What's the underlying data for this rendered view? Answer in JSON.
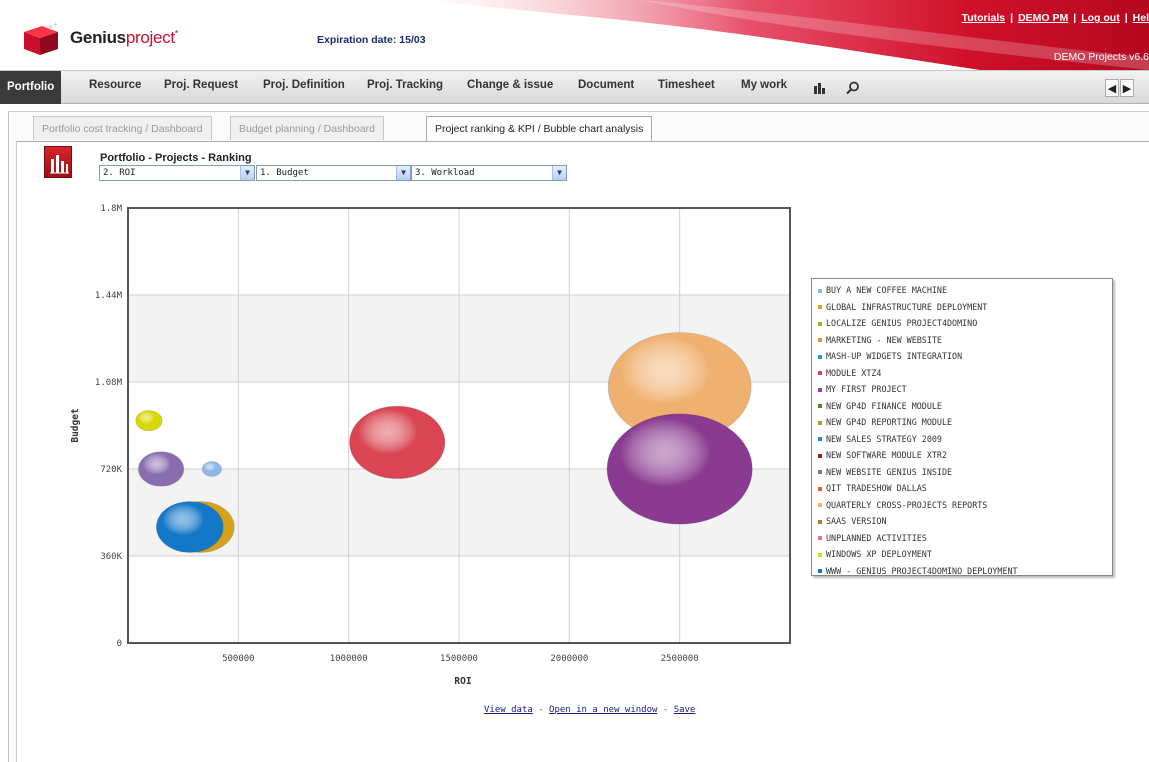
{
  "header": {
    "logo_name": "Genius",
    "logo_project": "project",
    "logo_mark": "*",
    "expiration": "Expiration date: 15/03",
    "links": [
      "Tutorials",
      "DEMO PM",
      "Log out",
      "Hel"
    ],
    "demo_projects": "DEMO Projects v6.6"
  },
  "nav": {
    "items": [
      "Portfolio",
      "Resource",
      "Proj. Request",
      "Proj. Definition",
      "Proj. Tracking",
      "Change & issue",
      "Document",
      "Timesheet",
      "My work"
    ],
    "active": "Portfolio",
    "icons": [
      "bar-chart-icon",
      "search-icon"
    ]
  },
  "tabs": [
    {
      "label": "Portfolio cost tracking / Dashboard",
      "active": false
    },
    {
      "label": "Budget planning / Dashboard",
      "active": false
    },
    {
      "label": "Project ranking & KPI / Bubble chart analysis",
      "active": true
    }
  ],
  "ranking": {
    "title": "Portfolio - Projects - Ranking",
    "selects": [
      "2. ROI",
      "1. Budget",
      "3. Workload"
    ]
  },
  "chart_data": {
    "type": "bubble",
    "xlabel": "ROI",
    "ylabel": "Budget",
    "xlim": [
      0,
      3000000
    ],
    "ylim": [
      0,
      1800000
    ],
    "x_ticks": [
      "500000",
      "1000000",
      "1500000",
      "2000000",
      "2500000"
    ],
    "x_tick_values": [
      500000,
      1000000,
      1500000,
      2000000,
      2500000
    ],
    "y_ticks": [
      "0",
      "360K",
      "720K",
      "1.08M",
      "1.44M",
      "1.8M"
    ],
    "y_tick_values": [
      0,
      360000,
      720000,
      1080000,
      1440000,
      1800000
    ],
    "grid": true,
    "legend_position": "right",
    "series": [
      {
        "name": "BUY A NEW COFFEE MACHINE",
        "color": "#8fb8e8",
        "x": 380000,
        "y": 720000,
        "size": 0.8
      },
      {
        "name": "GLOBAL INFRASTRUCTURE DEPLOYMENT",
        "color": "#d6a21e",
        "x": 330000,
        "y": 480000,
        "size": 2.8
      },
      {
        "name": "LOCALIZE GENIUS PROJECT4DOMINO",
        "color": "#8cbf26"
      },
      {
        "name": "MARKETING - NEW WEBSITE",
        "color": "#f08c50"
      },
      {
        "name": "MASH-UP WIDGETS INTEGRATION",
        "color": "#2aa0b8"
      },
      {
        "name": "MODULE XTZ4",
        "color": "#d94552",
        "x": 1220000,
        "y": 830000,
        "size": 4.0
      },
      {
        "name": "MY FIRST PROJECT",
        "color": "#9e3fa8"
      },
      {
        "name": "NEW GP4D FINANCE MODULE",
        "color": "#4c8a2a"
      },
      {
        "name": "NEW GP4D REPORTING MODULE",
        "color": "#a4a418"
      },
      {
        "name": "NEW SALES STRATEGY 2009",
        "color": "#1e8fc8"
      },
      {
        "name": "NEW SOFTWARE MODULE XTR2",
        "color": "#a02020"
      },
      {
        "name": "NEW WEBSITE GENIUS INSIDE",
        "color": "#8a6cb0",
        "x": 150000,
        "y": 720000,
        "size": 1.9
      },
      {
        "name": "QIT TRADESHOW DALLAS",
        "color": "#e06020"
      },
      {
        "name": "QUARTERLY CROSS-PROJECTS REPORTS",
        "color": "#f0b070",
        "x": 2500000,
        "y": 1060000,
        "size": 6.0
      },
      {
        "name": "SAAS VERSION",
        "color": "#b08030"
      },
      {
        "name": "UNPLANNED ACTIVITIES",
        "color": "#e870a0"
      },
      {
        "name": "WINDOWS XP DEPLOYMENT",
        "color": "#d8d800",
        "x": 95000,
        "y": 920000,
        "size": 1.1
      },
      {
        "name": "WWW - GENIUS PROJECT4DOMINO DEPLOYMENT",
        "color": "#1478c8",
        "x": 280000,
        "y": 480000,
        "size": 2.8
      }
    ],
    "extra_bubbles": [
      {
        "color": "#8a3a90",
        "x": 2500000,
        "y": 720000,
        "size": 6.1
      }
    ]
  },
  "footer": {
    "links": [
      "View data",
      "Open in a new window",
      "Save"
    ],
    "separator": " - "
  }
}
